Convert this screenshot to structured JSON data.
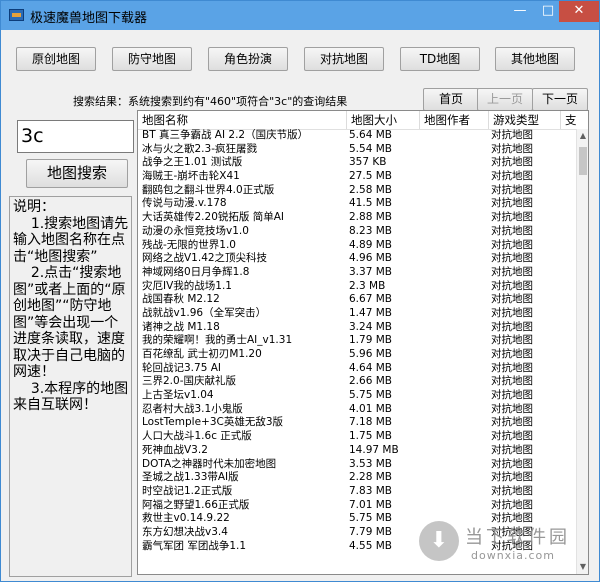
{
  "window": {
    "title": "极速魔兽地图下载器",
    "controls": {
      "minimize": "—",
      "maximize": "□",
      "close": "✕"
    }
  },
  "nav": {
    "buttons": [
      "原创地图",
      "防守地图",
      "角色扮演",
      "对抗地图",
      "TD地图",
      "其他地图"
    ]
  },
  "status": {
    "text": "搜索结果：系统搜索到约有\"460\"项符合\"3c\"的查询结果"
  },
  "pager": {
    "first": "首页",
    "prev": "上一页",
    "next": "下一页"
  },
  "search": {
    "value": "3c",
    "button": "地图搜索"
  },
  "help": {
    "text": "说明：\n    1.搜索地图请先输入地图名称在点击“地图搜索”\n    2.点击“搜索地图”或者上面的“原创地图”“防守地图”等会出现一个进度条读取，速度取决于自己电脑的网速！\n    3.本程序的地图来自互联网！"
  },
  "table": {
    "columns": [
      "地图名称",
      "地图大小",
      "地图作者",
      "游戏类型",
      "支"
    ],
    "rows": [
      [
        "BT 真三争霸战 AI 2.2（国庆节版）",
        "5.64 MB",
        "",
        "对抗地图"
      ],
      [
        "冰与火之歌2.3-疯狂屠戮",
        "5.54 MB",
        "",
        "对抗地图"
      ],
      [
        "战争之王1.01 测试版",
        "357 KB",
        "",
        "对抗地图"
      ],
      [
        "海贼王-崩坏击轮X41",
        "27.5 MB",
        "",
        "对抗地图"
      ],
      [
        "翻鸥包之翻斗世界4.0正式版",
        "2.58 MB",
        "",
        "对抗地图"
      ],
      [
        "传说与动漫.v.178",
        "41.5 MB",
        "",
        "对抗地图"
      ],
      [
        "大话英雄传2.20锐拓版 简单AI",
        "2.88 MB",
        "",
        "对抗地图"
      ],
      [
        "动漫の永恒竞技场v1.0",
        "8.23 MB",
        "",
        "对抗地图"
      ],
      [
        "残战-无限的世界1.0",
        "4.89 MB",
        "",
        "对抗地图"
      ],
      [
        "网络之战V1.42之顶尖科技",
        "4.96 MB",
        "",
        "对抗地图"
      ],
      [
        "神域网络0日月争辉1.8",
        "3.37 MB",
        "",
        "对抗地图"
      ],
      [
        "灾厄IV我的战场1.1",
        "2.3 MB",
        "",
        "对抗地图"
      ],
      [
        "战国春秋 M2.12",
        "6.67 MB",
        "",
        "对抗地图"
      ],
      [
        "战就战v1.96（全军突击）",
        "1.47 MB",
        "",
        "对抗地图"
      ],
      [
        "诸神之战 M1.18",
        "3.24 MB",
        "",
        "对抗地图"
      ],
      [
        "我的荣耀啊！我的勇士AI_v1.31",
        "1.79 MB",
        "",
        "对抗地图"
      ],
      [
        "百花缭乱 武士初刃M1.20",
        "5.96 MB",
        "",
        "对抗地图"
      ],
      [
        "轮回战记3.75 AI",
        "4.64 MB",
        "",
        "对抗地图"
      ],
      [
        "三界2.0-国庆献礼版",
        "2.66 MB",
        "",
        "对抗地图"
      ],
      [
        "上古圣坛v1.04",
        "5.75 MB",
        "",
        "对抗地图"
      ],
      [
        "忍者村大战3.1小鬼版",
        "4.01 MB",
        "",
        "对抗地图"
      ],
      [
        "LostTemple+3C英雄无敌3版",
        "7.18 MB",
        "",
        "对抗地图"
      ],
      [
        "人口大战斗1.6c 正式版",
        "1.75 MB",
        "",
        "对抗地图"
      ],
      [
        "死神血战V3.2",
        "14.97 MB",
        "",
        "对抗地图"
      ],
      [
        "DOTA之神器时代未加密地图",
        "3.53 MB",
        "",
        "对抗地图"
      ],
      [
        "圣城之战1.33带AI版",
        "2.28 MB",
        "",
        "对抗地图"
      ],
      [
        "时空战记1.2正式版",
        "7.83 MB",
        "",
        "对抗地图"
      ],
      [
        "阿福之野望1.66正式版",
        "7.01 MB",
        "",
        "对抗地图"
      ],
      [
        "救世主v0.14.9.22",
        "5.75 MB",
        "",
        "对抗地图"
      ],
      [
        "东方幻想决战v3.4",
        "7.79 MB",
        "",
        "对抗地图"
      ],
      [
        "霸气军团 军团战争1.1",
        "4.55 MB",
        "",
        "对抗地图"
      ]
    ]
  },
  "watermark": {
    "name": "当下软件园",
    "url": "downxia.com"
  }
}
